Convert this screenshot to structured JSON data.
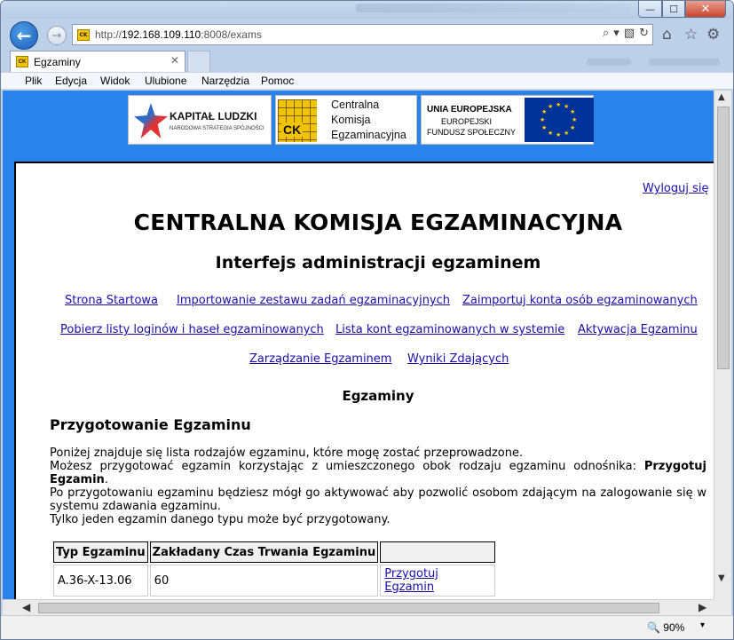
{
  "browser": {
    "url_prefix": "http://",
    "url_host": "192.168.109.110",
    "url_rest": ":8008/exams",
    "tab_title": "Egzaminy",
    "favicon_text": "CK",
    "back_glyph": "←",
    "forward_glyph": "→",
    "tab_close_glyph": "✕",
    "window_controls": {
      "minimize": "—",
      "maximize": "☐",
      "close": "✕"
    },
    "address_icons": {
      "search": "⌕",
      "dropdown": "▾",
      "compat": "▧",
      "refresh": "↻"
    },
    "toolbar_icons": {
      "home": "⌂",
      "favorites": "☆",
      "tools": "⚙"
    },
    "menu": [
      "Plik",
      "Edycja",
      "Widok",
      "Ulubione",
      "Narzędzia",
      "Pomoc"
    ],
    "scroll_glyphs": {
      "up": "▲",
      "down": "▼",
      "left": "◀",
      "right": "▶"
    },
    "zoom": "90%",
    "zoom_icon": "🔍",
    "zoom_dropdown": "▾"
  },
  "logos": {
    "kapital": {
      "title": "KAPITAŁ LUDZKI",
      "subtitle": "NARODOWA STRATEGIA SPÓJNOŚCI"
    },
    "cke": {
      "mark": "CK",
      "line1": "Centralna",
      "line2": "Komisja",
      "line3": "Egzaminacyjna"
    },
    "ue": {
      "line1": "UNIA EUROPEJSKA",
      "line2": "EUROPEJSKI",
      "line3": "FUNDUSZ SPOŁECZNY"
    }
  },
  "page": {
    "logout": "Wyloguj się",
    "title": "CENTRALNA KOMISJA EGZAMINACYJNA",
    "subtitle": "Interfejs administracji egzaminem",
    "nav": [
      "Strona Startowa",
      "Importowanie zestawu zadań egzaminacyjnych",
      "Zaimportuj konta osób egzaminowanych",
      "Pobierz listy loginów i haseł egzaminowanych",
      "Lista kont egzaminowanych w systemie",
      "Aktywacja Egzaminu",
      "Zarządzanie Egzaminem",
      "Wyniki Zdających"
    ],
    "section_title": "Egzaminy",
    "section_heading": "Przygotowanie Egzaminu",
    "para1": "Poniżej znajduje się lista rodzajów egzaminu, które mogę zostać przeprowadzone.",
    "para2_a": "Możesz przygotować egzamin korzystając z umieszczonego obok rodzaju egzaminu odnośnika: ",
    "para2_b": "Przygotuj Egzamin",
    "para2_c": ".",
    "para3": "Po przygotowaniu egzaminu będziesz mógł go aktywować aby pozwolić osobom zdającym na zalogowanie się w systemu zdawania egzaminu.",
    "para4": "Tylko jeden egzamin danego typu może być przygotowany.",
    "table": {
      "headers": [
        "Typ Egzaminu",
        "Zakładany Czas Trwania Egzaminu",
        ""
      ],
      "rows": [
        {
          "type": "A.36-X-13.06",
          "duration": "60",
          "action": "Przygotuj Egzamin"
        }
      ]
    }
  }
}
